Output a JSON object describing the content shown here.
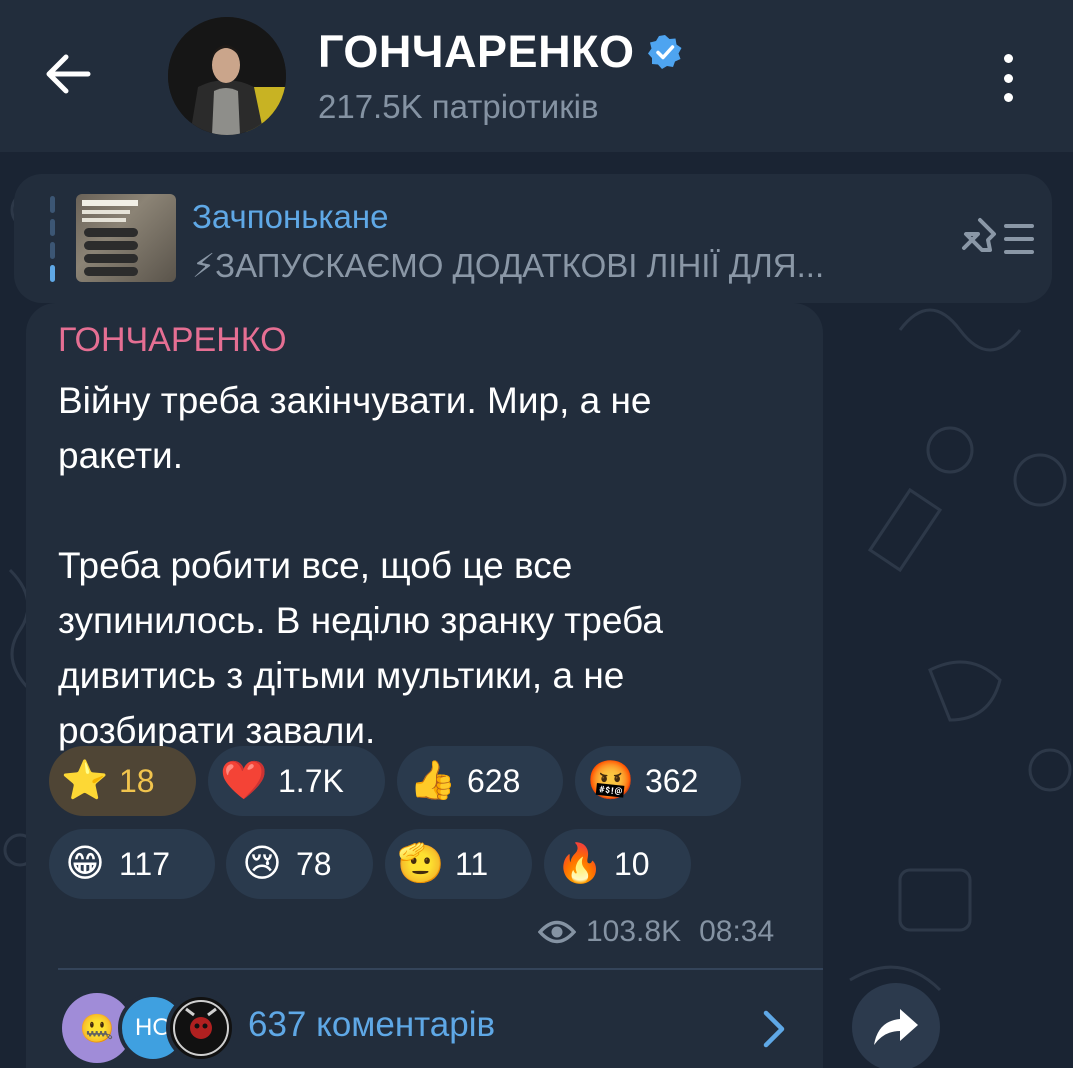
{
  "header": {
    "title": "ГОНЧАРЕНКО",
    "subtitle": "217.5K патріотиків",
    "verified_icon": "verified-badge-icon",
    "back_icon": "arrow-left-icon",
    "more_icon": "vertical-dots-icon"
  },
  "pinned": {
    "title": "Зачпонькане",
    "text": "⚡ЗАПУСКАЄМО ДОДАТКОВІ ЛІНІЇ ДЛЯ...",
    "thumb_heading": "ГАРЯЧА ЛІНІЯ",
    "list_icon": "pinned-list-icon"
  },
  "message": {
    "sender": "ГОНЧАРЕНКО",
    "text": "Війну треба закінчувати. Мир, а не\nракети.\n\nТреба робити все, щоб це все\nзупинилось. В неділю зранку треба\nдивитись з дітьми мультики, а не\nрозбирати завали.",
    "views": "103.8K",
    "time": "08:34",
    "comments_label": "637 коментарів",
    "comment_avatar_text": "НО",
    "comment_avatar_emoji": "🤐"
  },
  "reactions": [
    {
      "emoji": "⭐",
      "count": "18",
      "selected": true
    },
    {
      "emoji": "❤️",
      "count": "1.7K",
      "selected": false
    },
    {
      "emoji": "👍",
      "count": "628",
      "selected": false
    },
    {
      "emoji": "🤬",
      "count": "362",
      "selected": false
    },
    {
      "emoji": "😁",
      "count": "117",
      "selected": false
    },
    {
      "emoji": "😢",
      "count": "78",
      "selected": false
    },
    {
      "emoji": "🫡",
      "count": "11",
      "selected": false
    },
    {
      "emoji": "🔥",
      "count": "10",
      "selected": false
    }
  ],
  "colors": {
    "accent": "#5fa8e6",
    "sender": "#e56f93",
    "star_count": "#f1c44d"
  }
}
